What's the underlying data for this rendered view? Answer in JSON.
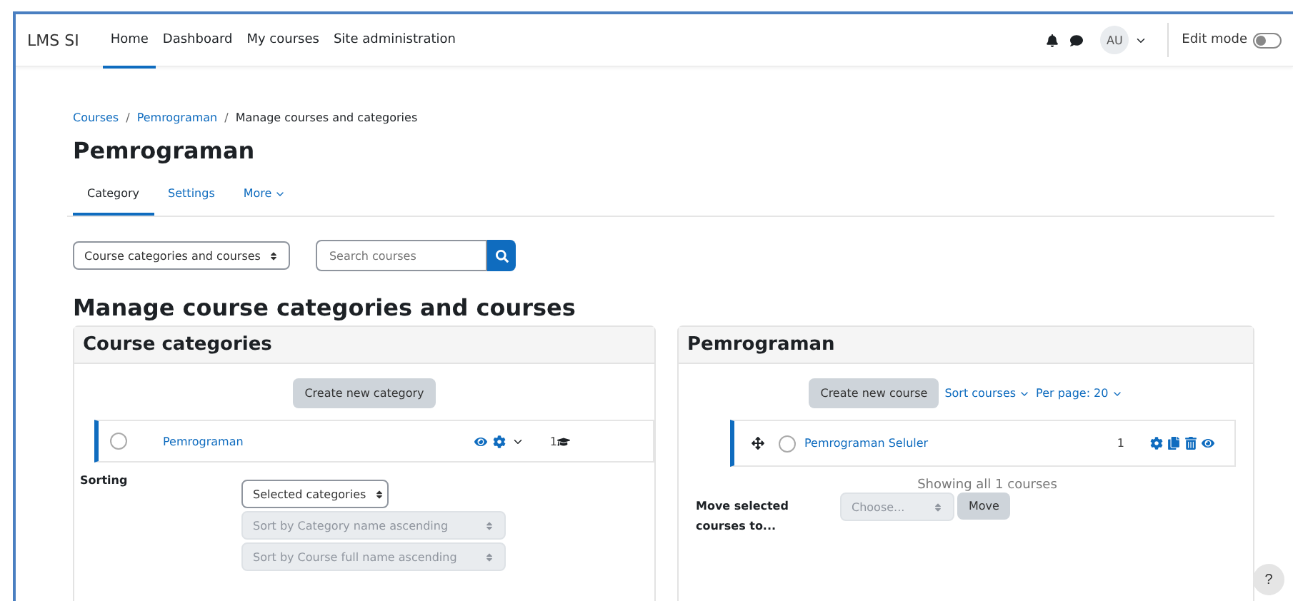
{
  "navbar": {
    "brand": "LMS SI",
    "items": [
      {
        "label": "Home",
        "selected": true
      },
      {
        "label": "Dashboard",
        "selected": false
      },
      {
        "label": "My courses",
        "selected": false
      },
      {
        "label": "Site administration",
        "selected": false
      }
    ],
    "avatar": "AU",
    "edit_mode": {
      "label": "Edit mode",
      "on": false
    }
  },
  "breadcrumb_separator": "/",
  "breadcrumb": [
    {
      "label": "Courses",
      "link": true
    },
    {
      "label": "Pemrograman",
      "link": true
    },
    {
      "label": "Manage courses and categories",
      "link": false
    }
  ],
  "title": "Pemrograman",
  "tabs": [
    {
      "label": "Category",
      "selected": true
    },
    {
      "label": "Settings",
      "selected": false
    },
    {
      "label": "More",
      "selected": false
    }
  ],
  "view_select": "Course categories and courses",
  "search": {
    "placeholder": "Search courses"
  },
  "heading": "Manage course categories and courses",
  "categories_panel": {
    "title": "Course categories",
    "create_button": "Create new category",
    "items": [
      {
        "name": "Pemrograman",
        "count": "1",
        "checked": false
      }
    ],
    "sorting": {
      "label": "Sorting",
      "select": "Selected categories",
      "options": [
        {
          "text": "Sort by Category name ascending",
          "disabled": true
        },
        {
          "text": "Sort by Course full name ascending",
          "disabled": true
        }
      ]
    }
  },
  "courses_panel": {
    "title": "Pemrograman",
    "create_button": "Create new course",
    "sort_link": "Sort courses",
    "per_page_link": "Per page: 20",
    "items": [
      {
        "name": "Pemrograman Seluler",
        "count": "1",
        "checked": false
      }
    ],
    "showing": "Showing all 1 courses",
    "move_label": "Move selected courses to...",
    "move_select": "Choose...",
    "move_button": "Move"
  },
  "help_button": "?"
}
